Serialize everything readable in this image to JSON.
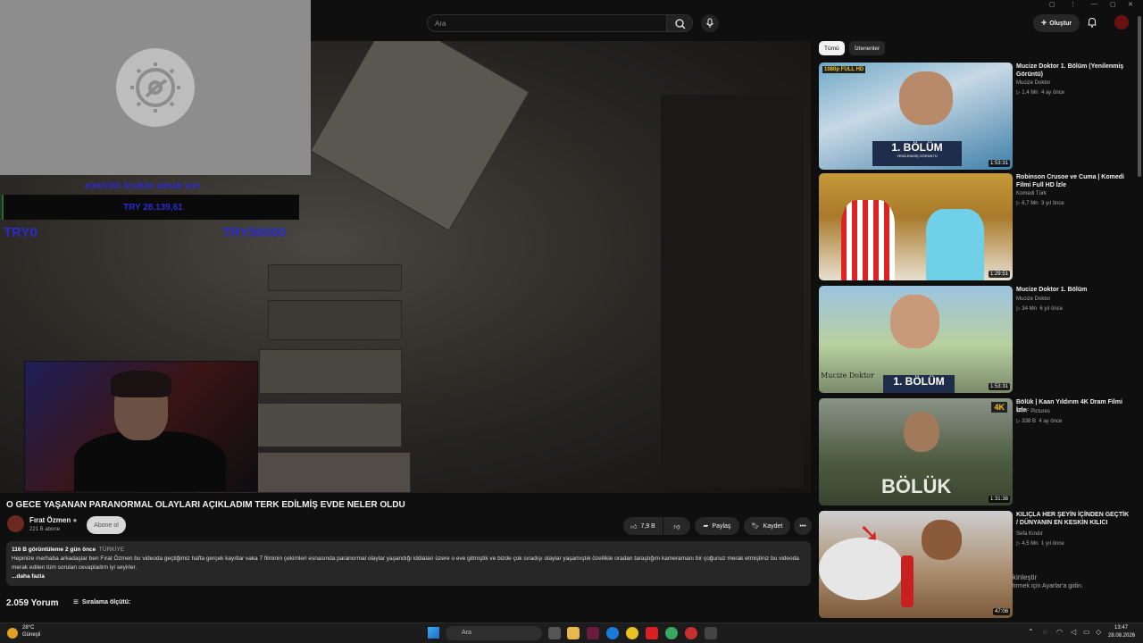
{
  "header": {
    "search_placeholder": "Ara",
    "create_label": "Oluştur"
  },
  "overlay": {
    "donation_label": "elektrikli bisiklet almak için",
    "donation_amount": "TRY 28.139,61",
    "goal_min": "TRY0",
    "goal_max": "TRY50000"
  },
  "video": {
    "title": "O GECE YAŞANAN PARANORMAL OLAYLARI AÇIKLADIM TERK EDİLMİŞ EVDE NELER OLDU",
    "channel": "Fırat Özmen",
    "subscribers": "221 B abone",
    "subscribe_label": "Abone ol",
    "likes": "7,9 B",
    "share_label": "Paylaş",
    "save_label": "Kaydet",
    "views_date": "116 B görüntüleme  2 gün önce",
    "country": "TÜRKİYE",
    "description": "Hepinize merhaba arkadaşlar ben Fırat Özmen bu videoda geçtiğimiz hafta gerçek kayıtlar vaka 7 filminin çekimleri esnasında paranormal olaylar yaşandığı iddiaları üzere o eve gitmiştik ve bizde çok sıradışı olaylar yaşamıştık özellikle oradan taraştığım kameramanı bir çoğunuz merak etmiştiniz bu videoda merak edilen tüm sorulan cevapladım iyi seyirler.",
    "more_label": "...daha fazla",
    "comments_count": "2.059 Yorum",
    "sort_label": "Sıralama ölçütü:"
  },
  "sidebar": {
    "chips": [
      "Tümü",
      "İzlenenler"
    ],
    "items": [
      {
        "title": "Mucize Doktor 1. Bölüm (Yenilenmiş Görüntü)",
        "channel": "Mucize Doktor",
        "views": "1,4 Mn",
        "age": "4 ay önce",
        "duration": "1:53:31",
        "badge": "1080p FULL HD",
        "caption": "1. BÖLÜM",
        "subcaption": "YENİLENMİŞ GÖRÜNTÜ"
      },
      {
        "title": "Robinson Crusoe ve Cuma | Komedi Filmi Full HD İzle",
        "channel": "Komedi Türk",
        "views": "6,7 Mn",
        "age": "3 yıl önce",
        "duration": "1:29:51"
      },
      {
        "title": "Mucize Doktor 1. Bölüm",
        "channel": "Mucize Doktor",
        "views": "34 Mn",
        "age": "6 yıl önce",
        "duration": "1:53:31",
        "caption": "1. BÖLÜM",
        "subcaption": "Mucize Doktor"
      },
      {
        "title": "Bölük | Kaan Yıldırım 4K Dram Filmi İzle",
        "channel": "TAFF Pictures",
        "views": "338 B",
        "age": "4 ay önce",
        "duration": "1:31:38",
        "badge": "4K",
        "caption": "BÖLÜK"
      },
      {
        "title": "KILIÇLA HER ŞEYİN İÇİNDEN GEÇTİK / DÜNYANIN EN KESKİN KILICI",
        "channel": "Sefa Kındır",
        "views": "4,5 Mn",
        "age": "1 yıl önce",
        "duration": "47:08"
      }
    ]
  },
  "activation": {
    "line1": "kinleştir",
    "line2": "tirmek için Ayarlar'a gidin."
  },
  "taskbar": {
    "temp": "28°C",
    "weather": "Güneşli",
    "search": "Ara",
    "time": "13:47",
    "date": "28.08.2026"
  }
}
